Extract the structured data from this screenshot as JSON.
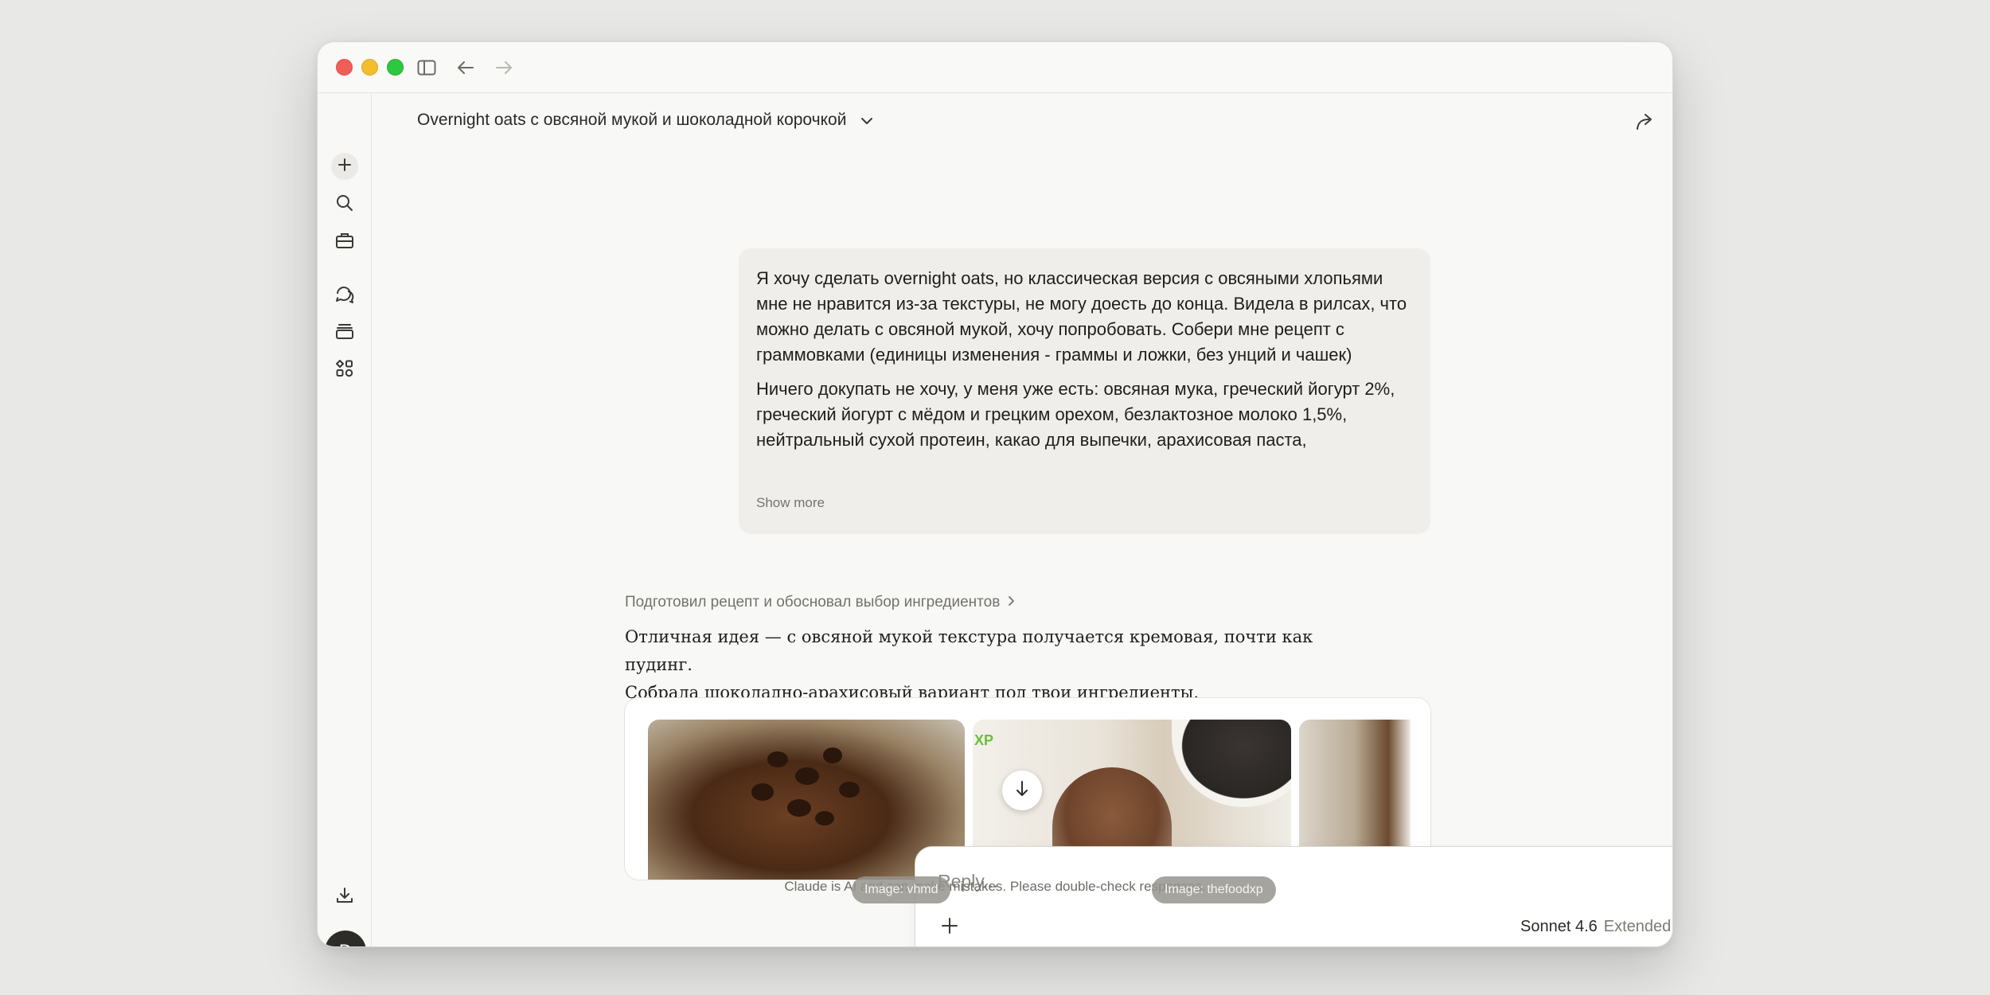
{
  "window": {
    "buttons": [
      "close",
      "minimize",
      "zoom"
    ]
  },
  "sidebar": {
    "items": [
      {
        "name": "new-chat",
        "icon": "plus-icon"
      },
      {
        "name": "search",
        "icon": "search-icon"
      },
      {
        "name": "customize",
        "icon": "briefcase-icon"
      },
      {
        "name": "chats",
        "icon": "chats-icon"
      },
      {
        "name": "projects",
        "icon": "projects-icon"
      },
      {
        "name": "artifacts",
        "icon": "artifacts-icon"
      },
      {
        "name": "download",
        "icon": "download-icon"
      }
    ],
    "avatar_initial": "D"
  },
  "header": {
    "title": "Overnight oats с овсяной мукой и шоколадной корочкой"
  },
  "user_message": {
    "paragraphs": [
      "Я хочу сделать overnight oats, но классическая версия с овсяными хлопьями мне не нравится из-за текстуры, не могу доесть до конца. Видела в рилсах, что можно делать с овсяной мукой, хочу попробовать. Собери мне рецепт с граммовками (единицы изменения - граммы и ложки, без унций и чашек)",
      "Ничего докупать не хочу,  у меня уже есть: овсяная мука, греческий йогурт 2%, греческий йогурт с мёдом и грецким орехом, безлактозное молоко 1,5%, нейтральный сухой протеин, какао для выпечки, арахисовая паста,"
    ],
    "show_more": "Show more"
  },
  "assistant": {
    "thinking_summary": "Подготовил рецепт и обосновал выбор ингредиентов",
    "text_lines": [
      "Отличная идея — с овсяной мукой текстура получается кремовая, почти как пудинг.",
      "Собрала шоколадно-арахисовый вариант под твои ингредиенты."
    ],
    "image_watermark": "XP"
  },
  "composer": {
    "placeholder": "Reply...",
    "model": "Sonnet 4.6",
    "mode": "Extended"
  },
  "footer": {
    "disclaimer": "Claude is AI and can make mistakes. Please double-check responses.",
    "image_credits": [
      "Image: vhmd",
      "Image: thefoodxp"
    ]
  }
}
